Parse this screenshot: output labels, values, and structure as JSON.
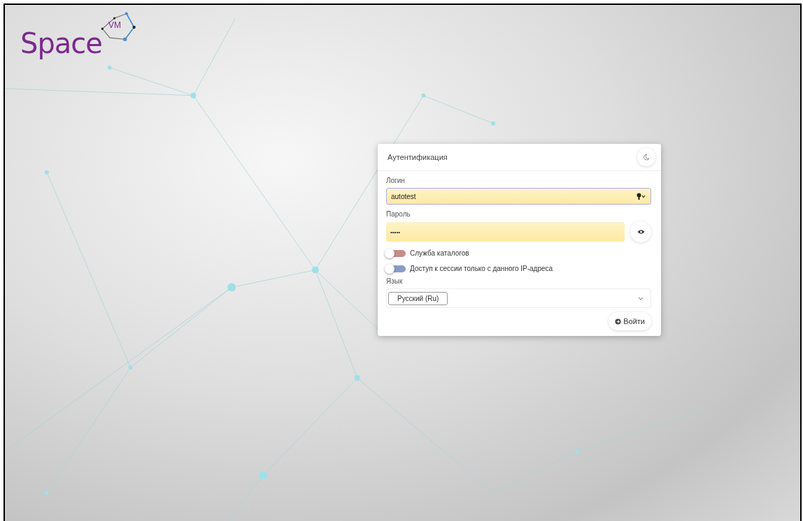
{
  "logo": {
    "word": "Space",
    "badge": "VM"
  },
  "card": {
    "title": "Аутентификация",
    "login": {
      "label": "Логин",
      "value": "autotest"
    },
    "password": {
      "label": "Пароль",
      "value": "•••••"
    },
    "toggles": [
      {
        "label": "Служба каталогов",
        "checked": false,
        "color": "#c98a8a"
      },
      {
        "label": "Доступ к сессии только с данного IP-адреса",
        "checked": false,
        "color": "#8a9cc9"
      }
    ],
    "language": {
      "label": "Язык",
      "value": "Русский (Ru)"
    },
    "submit": "Войти"
  }
}
